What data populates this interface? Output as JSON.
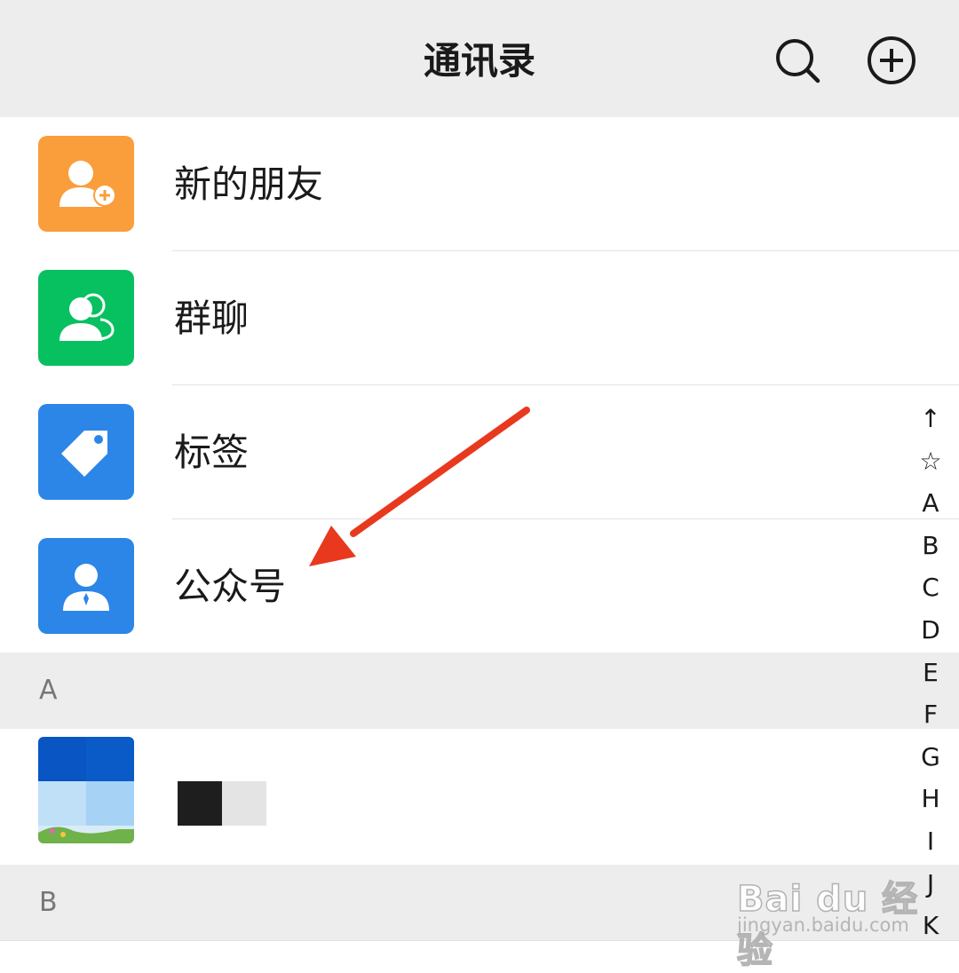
{
  "header": {
    "title": "通讯录",
    "search_icon": "search-icon",
    "add_icon": "plus-circle-icon"
  },
  "entries": [
    {
      "label": "新的朋友",
      "icon": "person-add-icon",
      "color": "#fa9d3b"
    },
    {
      "label": "群聊",
      "icon": "group-icon",
      "color": "#07c160"
    },
    {
      "label": "标签",
      "icon": "tag-icon",
      "color": "#2c86e8"
    },
    {
      "label": "公众号",
      "icon": "official-account-icon",
      "color": "#2c86e8"
    }
  ],
  "sections": [
    {
      "letter": "A"
    },
    {
      "letter": "B"
    }
  ],
  "index_bar": [
    "↑",
    "☆",
    "A",
    "B",
    "C",
    "D",
    "E",
    "F",
    "G",
    "H",
    "I",
    "J",
    "K"
  ],
  "annotation": {
    "arrow_color": "#e8391f"
  },
  "watermark": {
    "logo": "Bai du 经验",
    "url": "jingyan.baidu.com"
  }
}
